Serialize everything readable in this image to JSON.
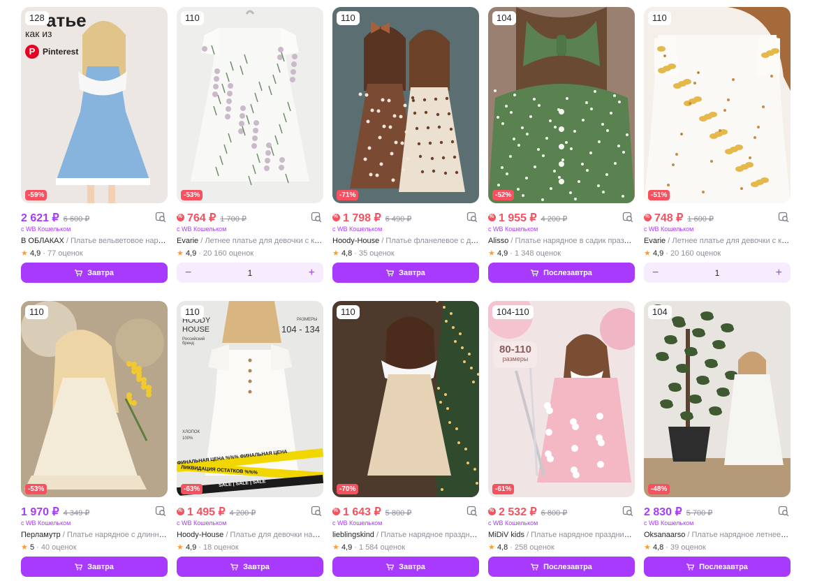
{
  "colors": {
    "accent": "#a73afd",
    "sale": "#f5515f",
    "muted": "#8e8e9a",
    "star": "#ff9a2e"
  },
  "cards": [
    {
      "size": "128",
      "discount": "-59%",
      "price": "2 621 ₽",
      "old_price": "6 600 ₽",
      "sale_icon": false,
      "wallet": "с WB Кошельком",
      "brand": "В ОБЛАКАХ",
      "name": " / Платье вельветовое нарядное",
      "rating": "4,9",
      "reviews": "· 77 оценок",
      "action": "button",
      "button_label": "Завтра",
      "overlay": {
        "line1": "атье",
        "line2": "как из",
        "pinterest": "Pinterest"
      }
    },
    {
      "size": "110",
      "discount": "-53%",
      "price": "764 ₽",
      "old_price": "1 700 ₽",
      "sale_icon": true,
      "wallet": "с WB Кошельком",
      "brand": "Evarie",
      "name": " / Летнее платье для девочки с коротким рукавом",
      "rating": "4,9",
      "reviews": "· 20 160 оценок",
      "action": "stepper",
      "qty": "1"
    },
    {
      "size": "110",
      "discount": "-71%",
      "price": "1 798 ₽",
      "old_price": "6 490 ₽",
      "sale_icon": true,
      "wallet": "с WB Кошельком",
      "brand": "Hoody-House",
      "name": " / Платье фланелевое с длинным рукавом",
      "rating": "4,8",
      "reviews": "· 35 оценок",
      "action": "button",
      "button_label": "Завтра"
    },
    {
      "size": "104",
      "discount": "-52%",
      "price": "1 955 ₽",
      "old_price": "4 200 ₽",
      "sale_icon": true,
      "wallet": "с WB Кошельком",
      "brand": "Alisso",
      "name": " / Платье нарядное в садик праздничное",
      "rating": "4,9",
      "reviews": "· 1 348 оценок",
      "action": "button",
      "button_label": "Послезавтра"
    },
    {
      "size": "110",
      "discount": "-51%",
      "price": "748 ₽",
      "old_price": "1 600 ₽",
      "sale_icon": true,
      "wallet": "с WB Кошельком",
      "brand": "Evarie",
      "name": " / Летнее платье для девочки с коротким рукавом",
      "rating": "4,9",
      "reviews": "· 20 160 оценок",
      "action": "stepper",
      "qty": "1"
    },
    {
      "size": "110",
      "discount": "-53%",
      "price": "1 970 ₽",
      "old_price": "4 349 ₽",
      "sale_icon": false,
      "wallet": "с WB Кошельком",
      "brand": "Перламутр",
      "name": " / Платье нарядное с длинным рукавом",
      "rating": "5",
      "reviews": "· 40 оценок",
      "action": "button",
      "button_label": "Завтра"
    },
    {
      "size": "110",
      "discount": "-63%",
      "price": "1 495 ₽",
      "old_price": "4 200 ₽",
      "sale_icon": true,
      "wallet": "с WB Кошельком",
      "brand": "Hoody-House",
      "name": " / Платье для девочки нарядное",
      "rating": "4,9",
      "reviews": "· 18 оценок",
      "action": "button",
      "button_label": "Завтра",
      "overlay": {
        "brand1": "HOODY",
        "brand2": "HOUSE",
        "brand_sub": "Российский бренд",
        "sizes_label": "РАЗМЕРЫ",
        "sizes": "104 - 134",
        "fabric": "ХЛОПОК",
        "fabric_pct": "100%",
        "tape1": "ФИНАЛЬНАЯ ЦЕНА %%% ФИНАЛЬНАЯ ЦЕНА",
        "tape2": "ЛИКВИДАЦИЯ ОСТАТКОВ %%%",
        "tape3": "SALE | SALE | SALE"
      }
    },
    {
      "size": "110",
      "discount": "-70%",
      "price": "1 643 ₽",
      "old_price": "5 800 ₽",
      "sale_icon": true,
      "wallet": "с WB Кошельком",
      "brand": "lieblingskind",
      "name": " / Платье нарядное праздничное",
      "rating": "4,9",
      "reviews": "· 1 584 оценок",
      "action": "button",
      "button_label": "Завтра"
    },
    {
      "size": "104-110",
      "discount": "-61%",
      "price": "2 532 ₽",
      "old_price": "6 800 ₽",
      "sale_icon": true,
      "wallet": "с WB Кошельком",
      "brand": "MiDiV kids",
      "name": " / Платье нарядное праздничное",
      "rating": "4,8",
      "reviews": "· 258 оценок",
      "action": "button",
      "button_label": "Послезавтра",
      "overlay": {
        "range": "80-110",
        "range_sub": "размеры"
      }
    },
    {
      "size": "104",
      "discount": "-48%",
      "price": "2 830 ₽",
      "old_price": "5 700 ₽",
      "sale_icon": false,
      "wallet": "с WB Кошельком",
      "brand": "Oksanaarso",
      "name": " / Платье нарядное летнее и праздничное",
      "rating": "4,8",
      "reviews": "· 39 оценок",
      "action": "button",
      "button_label": "Послезавтра"
    }
  ]
}
